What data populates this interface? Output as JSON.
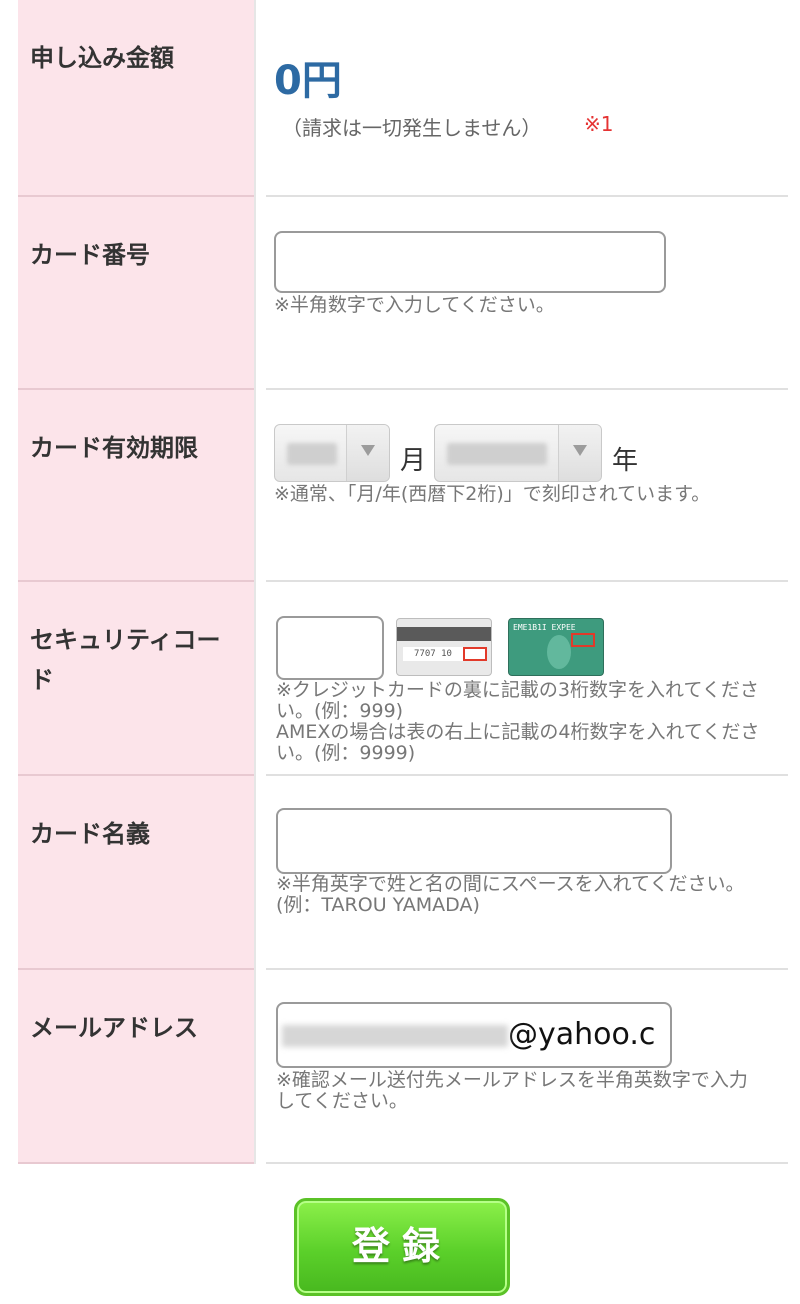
{
  "form": {
    "amount": {
      "label": "申し込み金額",
      "value": "0円",
      "note": "（請求は一切発生しません）",
      "ref": "※1"
    },
    "card_number": {
      "label": "カード番号",
      "value": "",
      "hint": "※半角数字で入力してください。"
    },
    "expiry": {
      "label": "カード有効期限",
      "month_unit": "月",
      "year_unit": "年",
      "hint": "※通常、「月/年(西暦下2桁)」で刻印されています。"
    },
    "security_code": {
      "label": "セキュリティコード",
      "value": "",
      "hint_line1": "※クレジットカードの裏に記載の3桁数字を入れてください。(例：999)",
      "hint_line2": "AMEXの場合は表の右上に記載の4桁数字を入れてください。(例：9999)"
    },
    "card_name": {
      "label": "カード名義",
      "value": "",
      "hint": "※半角英字で姓と名の間にスペースを入れてください。(例：TAROU YAMADA)"
    },
    "email": {
      "label": "メールアドレス",
      "visible_value": "@yahoo.c",
      "hint": "※確認メール送付先メールアドレスを半角英数字で入力してください。"
    }
  },
  "submit_label": "登録",
  "colors": {
    "label_bg": "#fce4ea",
    "amount_blue": "#2d6aa3",
    "ref_red": "#e53333",
    "button_green": "#5bd02a"
  }
}
